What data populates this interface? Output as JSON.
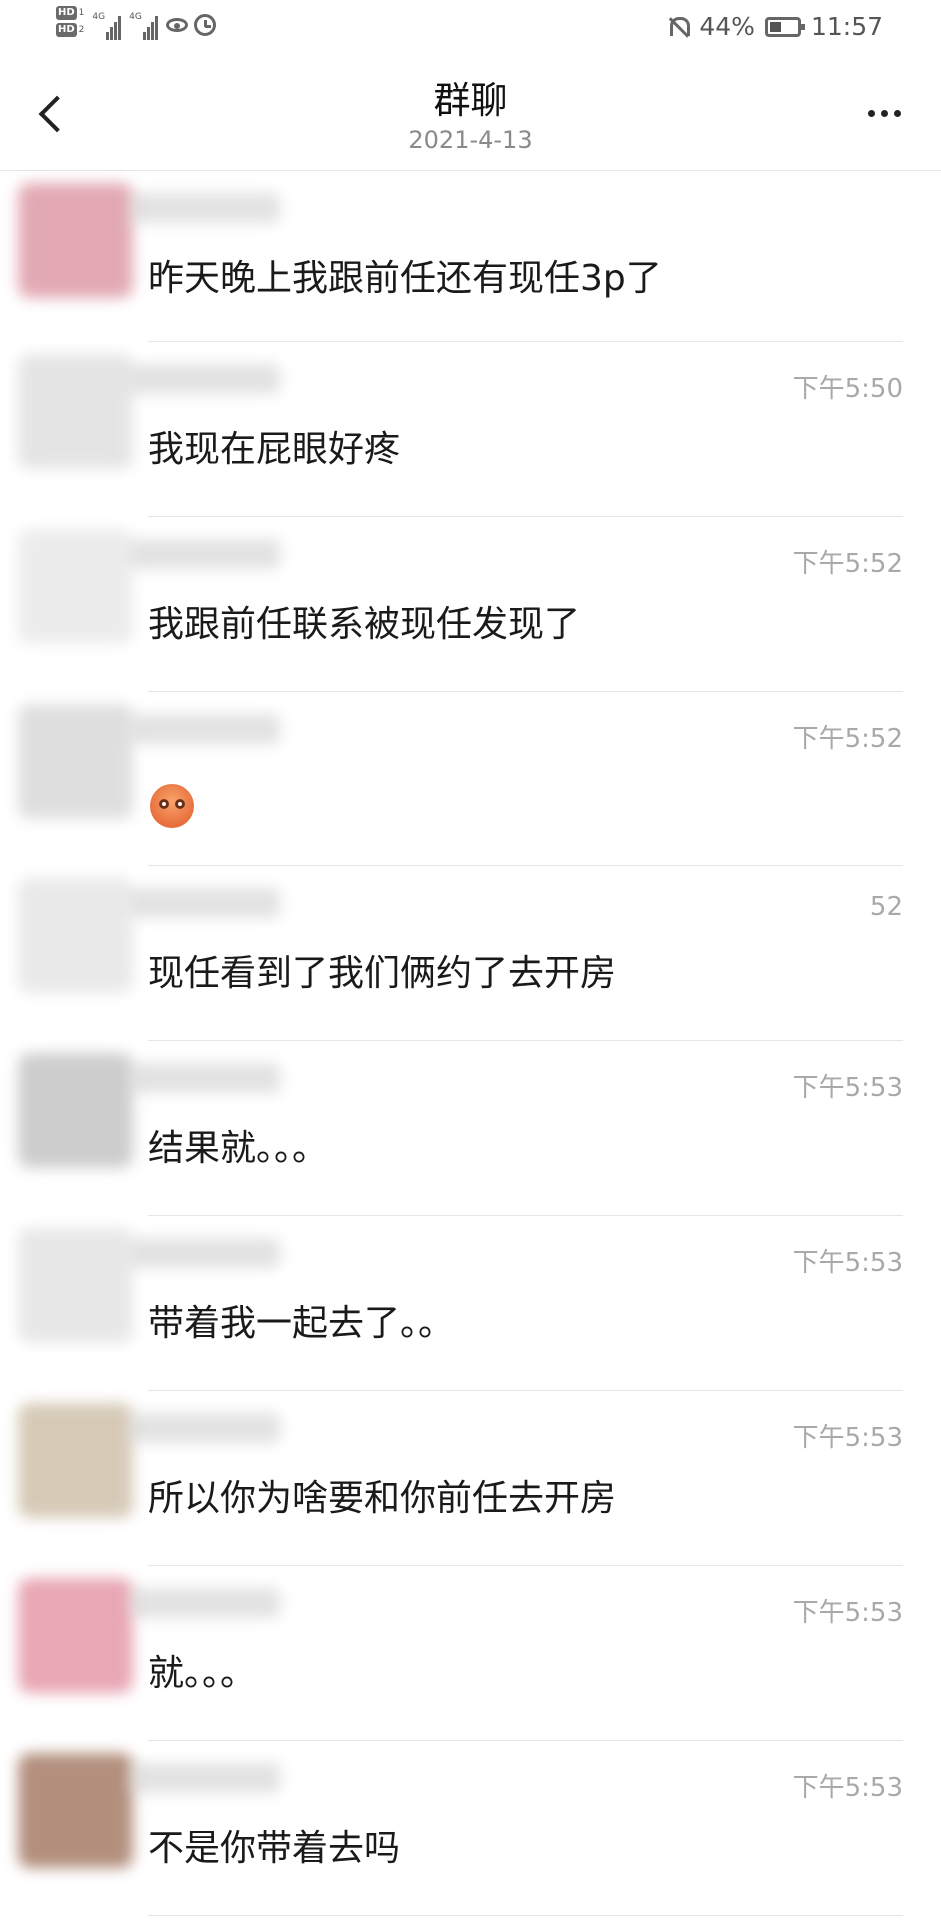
{
  "status_bar": {
    "hd1_badge": "HD",
    "hd1_sub": "1",
    "hd2_badge": "HD",
    "hd2_sub": "2",
    "net1": "4G",
    "net2": "4G",
    "battery_level": 0.44,
    "battery_text": "44%",
    "time": "11:57"
  },
  "header": {
    "title": "群聊",
    "date": "2021-4-13",
    "back_icon": "chevron-left-icon",
    "more_icon": "more-dots-icon"
  },
  "messages": [
    {
      "time": "",
      "text": "昨天晚上我跟前任还有现任3p了"
    },
    {
      "time": "下午5:50",
      "text": "我现在屁眼好疼"
    },
    {
      "time": "下午5:52",
      "text": "我跟前任联系被现任发现了"
    },
    {
      "time": "下午5:52",
      "text": "",
      "emoji": "surprised-face-emoji"
    },
    {
      "time": "52",
      "text": "现任看到了我们俩约了去开房"
    },
    {
      "time": "下午5:53",
      "text": "结果就。。。"
    },
    {
      "time": "下午5:53",
      "text": "带着我一起去了。。"
    },
    {
      "time": "下午5:53",
      "text": "所以你为啥要和你前任去开房"
    },
    {
      "time": "下午5:53",
      "text": "就。。。"
    },
    {
      "time": "下午5:53",
      "text": "不是你带着去吗"
    }
  ],
  "avatar_colors": [
    "#d98d9a",
    "#dcdcdc",
    "#e6e6e6",
    "#d4d4d4",
    "#e2e2e2",
    "#bdbdbd",
    "#e0e0e0",
    "#c9b9a0",
    "#e18a9c",
    "#9a6a52"
  ]
}
